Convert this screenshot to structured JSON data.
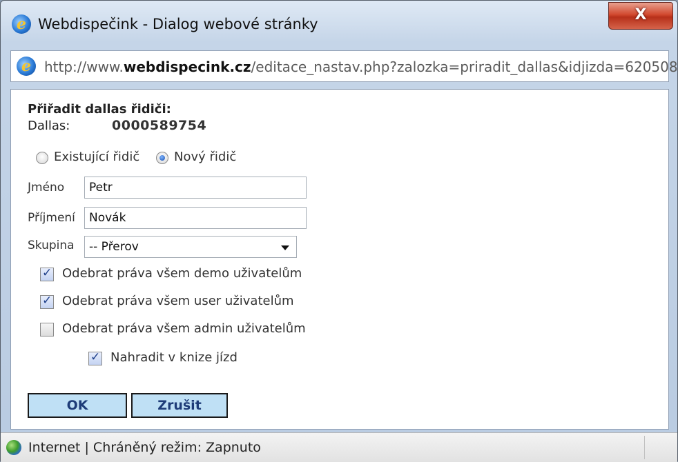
{
  "window": {
    "title": "Webdispečink - Dialog webové stránky",
    "close_glyph": "X"
  },
  "address": {
    "prefix": "http://www.",
    "domain": "webdispecink.cz",
    "path": "/editace_nastav.php?zalozka=priradit_dallas&idjizda=620508"
  },
  "form": {
    "heading": "Přiřadit dallas řidiči:",
    "dallas_label": "Dallas:",
    "dallas_value": "0000589754",
    "radio_existing": "Existující řidič",
    "radio_new": "Nový řidič",
    "selected_radio": "new",
    "jmeno_label": "Jméno",
    "jmeno_value": "Petr",
    "prijmeni_label": "Příjmení",
    "prijmeni_value": "Novák",
    "skupina_label": "Skupina",
    "skupina_value": "-- Přerov",
    "cb_demo": "Odebrat práva všem demo uživatelům",
    "cb_user": "Odebrat práva všem user uživatelům",
    "cb_admin": "Odebrat práva všem admin uživatelům",
    "cb_kniha": "Nahradit v knize jízd",
    "cb_demo_checked": true,
    "cb_user_checked": true,
    "cb_admin_checked": false,
    "cb_kniha_checked": true,
    "ok_label": "OK",
    "cancel_label": "Zrušit"
  },
  "status": {
    "text": "Internet | Chráněný režim: Zapnuto"
  },
  "icons": {
    "title": "ie-icon",
    "address": "ie-page-icon",
    "status": "globe-icon"
  },
  "colors": {
    "button_bg": "#bfe0f5",
    "close_red": "#d2492f"
  }
}
